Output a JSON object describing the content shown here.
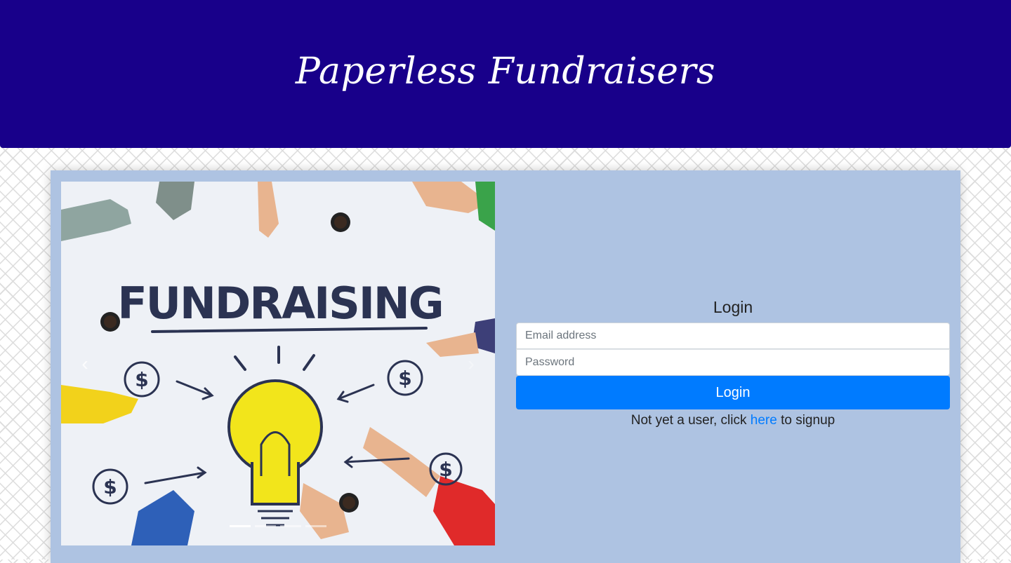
{
  "header": {
    "title": "Paperless Fundraisers"
  },
  "carousel": {
    "image_text": "FUNDRAISING",
    "prev_icon": "chevron-left-icon",
    "next_icon": "chevron-right-icon",
    "prev_glyph": "‹",
    "next_glyph": "›",
    "indicator_count": 4,
    "active_index": 0
  },
  "login": {
    "heading": "Login",
    "email_placeholder": "Email address",
    "password_placeholder": "Password",
    "button_label": "Login",
    "signup_prefix": "Not yet a user, click ",
    "signup_link": "here",
    "signup_suffix": " to signup"
  },
  "colors": {
    "header_bg": "#18008a",
    "card_bg": "#aec3e2",
    "primary": "#007bff"
  }
}
